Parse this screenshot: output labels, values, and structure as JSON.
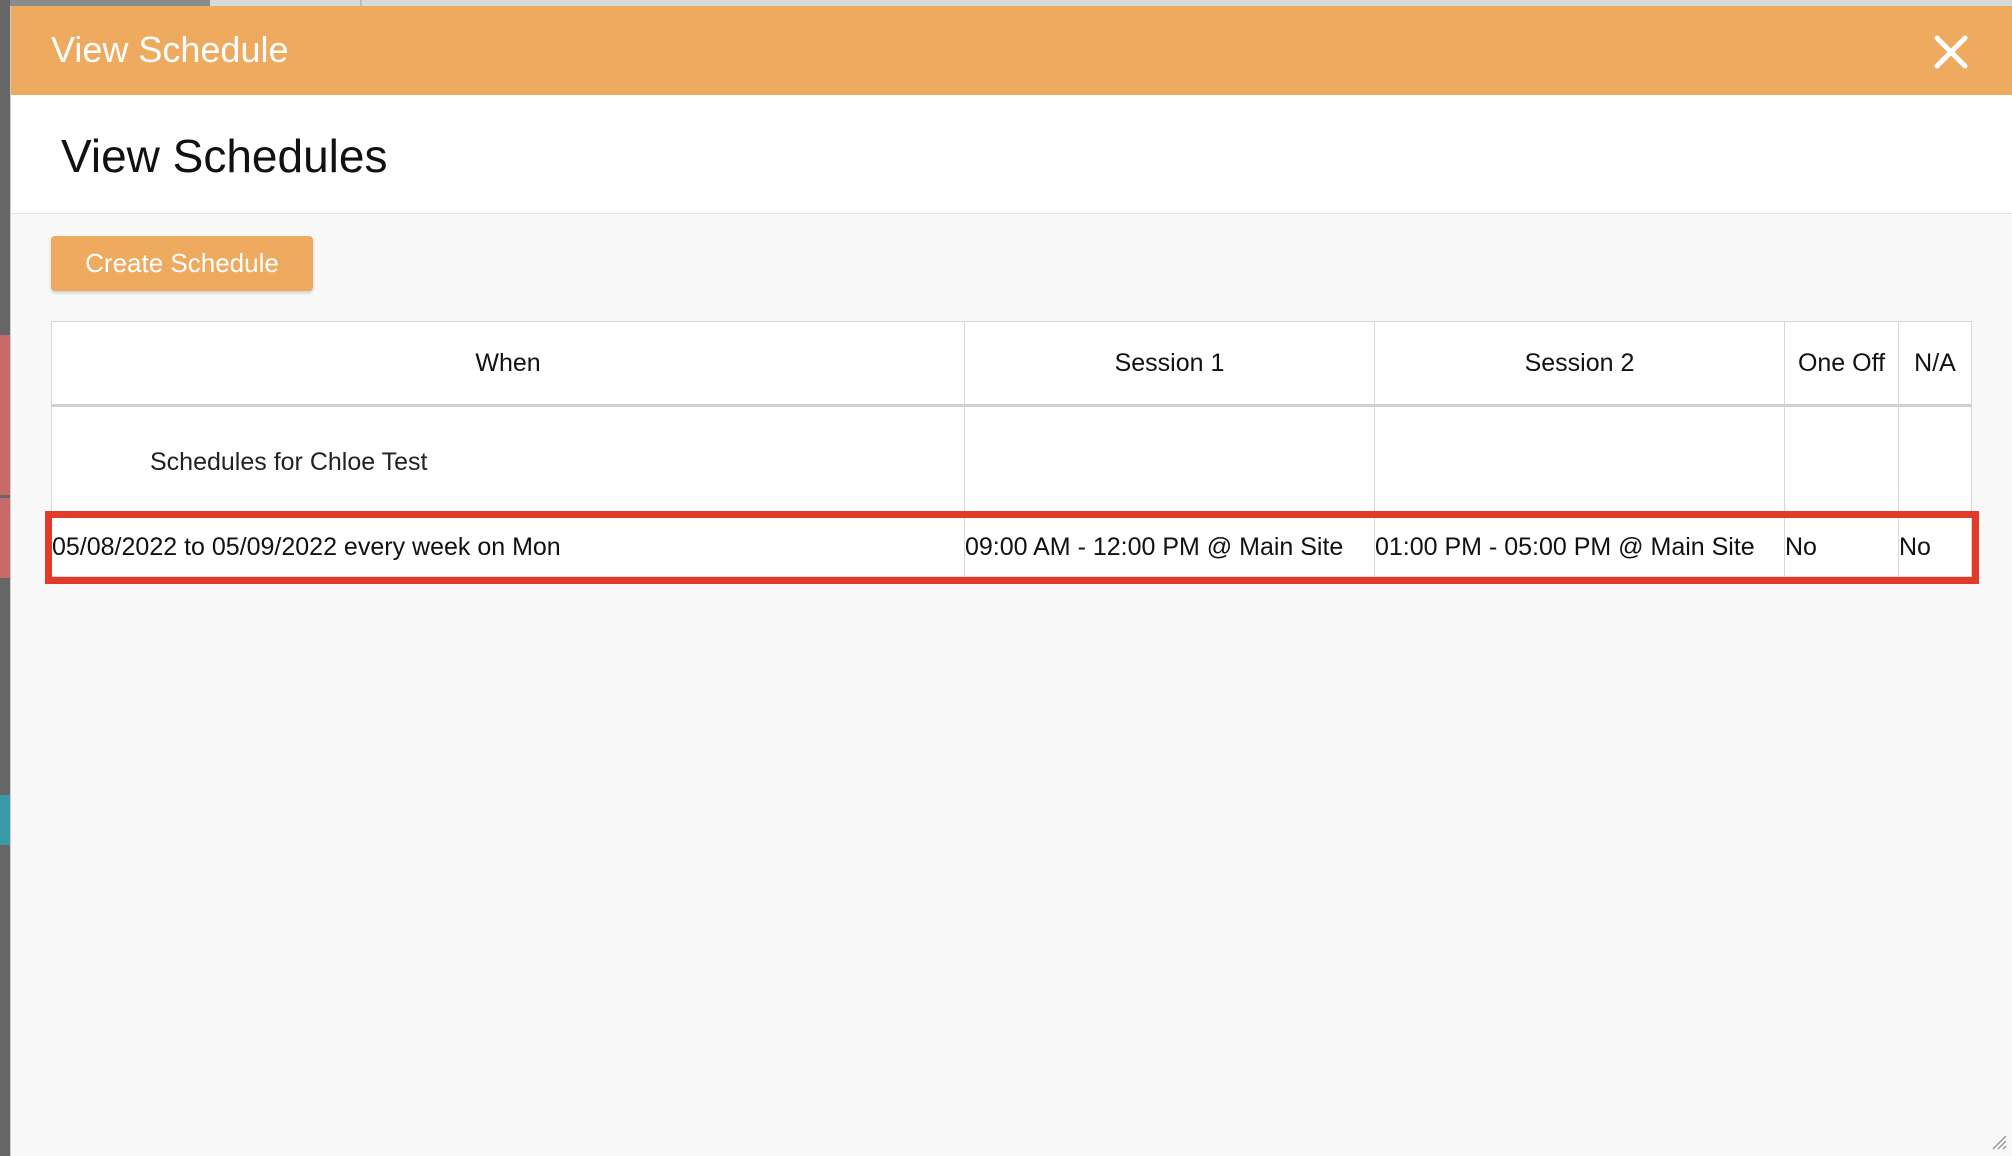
{
  "dialog": {
    "title": "View Schedule",
    "close_icon": "close-icon",
    "header_color": "#eeaa5f"
  },
  "page": {
    "heading": "View Schedules"
  },
  "toolbar": {
    "create_label": "Create Schedule"
  },
  "table": {
    "columns": [
      "When",
      "Session 1",
      "Session 2",
      "One Off",
      "N/A"
    ],
    "caption": "Schedules for Chloe Test",
    "rows": [
      {
        "when": "05/08/2022 to 05/09/2022 every week on Mon",
        "session1": "09:00 AM - 12:00 PM @ Main Site",
        "session2": "01:00 PM - 05:00 PM @ Main Site",
        "one_off": "No",
        "na": "No"
      }
    ],
    "highlight_color": "#e23b2a"
  }
}
